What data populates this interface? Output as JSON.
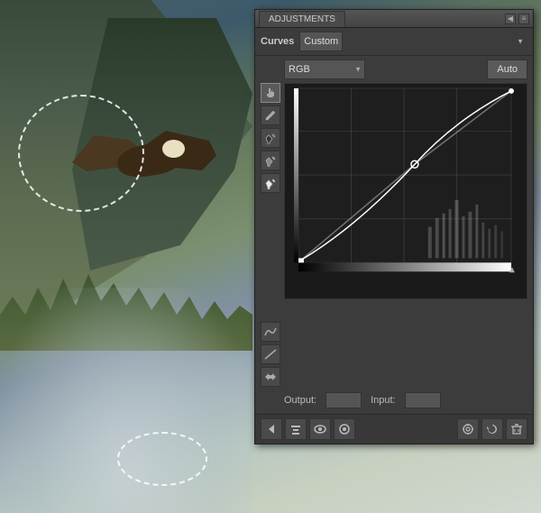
{
  "panel": {
    "title": "ADJUSTMENTS",
    "preset_label": "Custom",
    "channel": "RGB",
    "auto_label": "Auto",
    "output_label": "Output:",
    "input_label": "Input:",
    "output_value": "",
    "input_value": ""
  },
  "toolbar": {
    "collapse_label": "◀",
    "menu_label": "≡"
  },
  "footer_buttons": {
    "back": "◀",
    "clip": "⊡",
    "eye": "●",
    "target": "◎",
    "refresh": "↺",
    "trash": "🗑"
  },
  "grid": {
    "lines_h": [
      25,
      50,
      75
    ],
    "lines_v": [
      25,
      50,
      75
    ]
  }
}
